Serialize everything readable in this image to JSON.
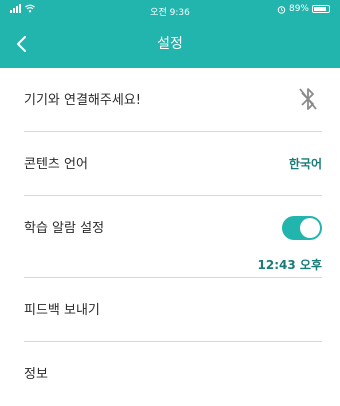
{
  "status": {
    "time": "오전 9:36",
    "battery_text": "89%",
    "battery_level": 0.89
  },
  "nav": {
    "title": "설정",
    "back_icon": "chevron-left-icon"
  },
  "colors": {
    "header": "#22b5ad",
    "accent_text": "#1a7c77",
    "toggle_on": "#22b5ad"
  },
  "settings": {
    "device": {
      "label": "기기와 연결해주세요!",
      "icon": "bluetooth-disconnected-icon"
    },
    "language": {
      "label": "콘텐츠 언어",
      "value": "한국어"
    },
    "alarm": {
      "label": "학습 알람 설정",
      "enabled": true,
      "time": "12:43 오후"
    },
    "feedback": {
      "label": "피드백 보내기"
    },
    "info": {
      "label": "정보"
    }
  }
}
